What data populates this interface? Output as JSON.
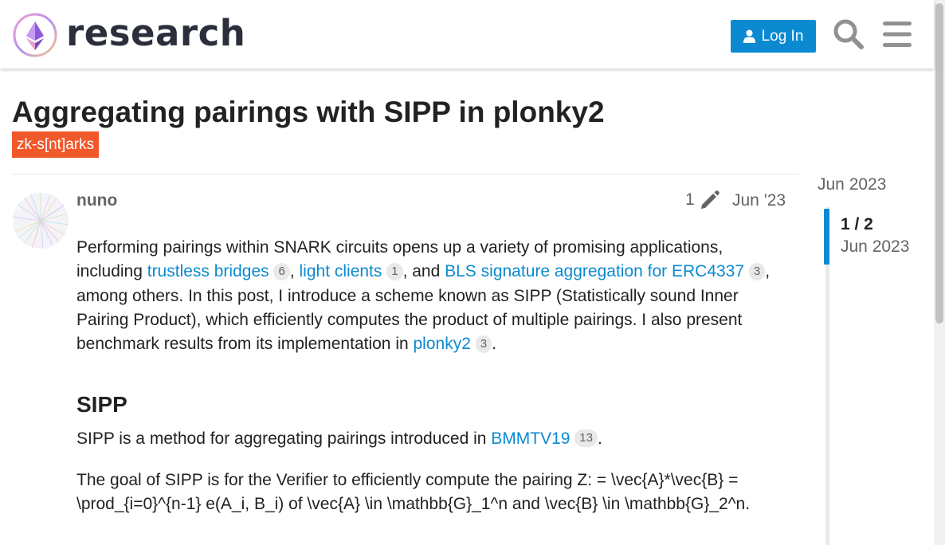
{
  "header": {
    "logo_text": "research",
    "login_label": "Log In",
    "search_icon": "search-icon",
    "menu_icon": "hamburger-menu-icon"
  },
  "topic": {
    "title": "Aggregating pairings with SIPP in plonky2",
    "tag": "zk-s[nt]arks"
  },
  "post": {
    "username": "nuno",
    "edit_count": "1",
    "date": "Jun '23",
    "p1": {
      "t1": "Performing pairings within SNARK circuits opens up a variety of promising applications, including ",
      "link1": "trustless bridges",
      "badge1": "6",
      "t2": ", ",
      "link2": "light clients",
      "badge2": "1",
      "t3": ", and ",
      "link3": "BLS signature aggregation for ERC4337",
      "badge3": "3",
      "t4": ", among others. In this post, I introduce a scheme known as SIPP (Statistically sound Inner Pairing Product), which efficiently computes the product of multiple pairings. I also present benchmark results from its implementation in ",
      "link4": "plonky2",
      "badge4": "3",
      "t5": "."
    },
    "heading": "SIPP",
    "p2": {
      "t1": "SIPP is a method for aggregating pairings introduced in ",
      "link": "BMMTV19",
      "badge": "13",
      "t2": "."
    },
    "p3": "The goal of SIPP is for the Verifier to efficiently compute the pairing Z: = \\vec{A}*\\vec{B} = \\prod_{i=0}^{n-1} e(A_i, B_i) of \\vec{A} \\in \\mathbb{G}_1^n and \\vec{B} \\in \\mathbb{G}_2^n."
  },
  "timeline": {
    "start": "Jun 2023",
    "position": "1 / 2",
    "date": "Jun 2023"
  },
  "colors": {
    "accent": "#0b8ad1",
    "tag": "#f1592a",
    "text": "#222222",
    "muted": "#646464"
  }
}
